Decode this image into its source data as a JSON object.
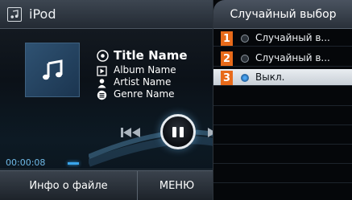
{
  "player": {
    "source_title": "iPod",
    "track": {
      "title": "Title Name",
      "album": "Album Name",
      "artist": "Artist Name",
      "genre": "Genre Name"
    },
    "elapsed_time": "00:00:08",
    "progress_fraction": 0.02,
    "bottom_buttons": {
      "info_label": "Инфо о файле",
      "menu_label": "МЕНЮ"
    },
    "icons": [
      "ipod-icon",
      "music-note-icon",
      "title-icon",
      "album-icon",
      "artist-icon",
      "genre-icon",
      "previous-icon",
      "pause-icon",
      "next-icon"
    ]
  },
  "random_panel": {
    "title": "Случайный выбор",
    "options": [
      {
        "number": "1",
        "label": "Случайный в...",
        "selected": false
      },
      {
        "number": "2",
        "label": "Случайный в...",
        "selected": false
      },
      {
        "number": "3",
        "label": "Выкл.",
        "selected": true
      }
    ]
  },
  "colors": {
    "accent_orange": "#e86a1a",
    "progress_blue": "#3aa6ec",
    "selected_row": "#dfe4e9"
  }
}
